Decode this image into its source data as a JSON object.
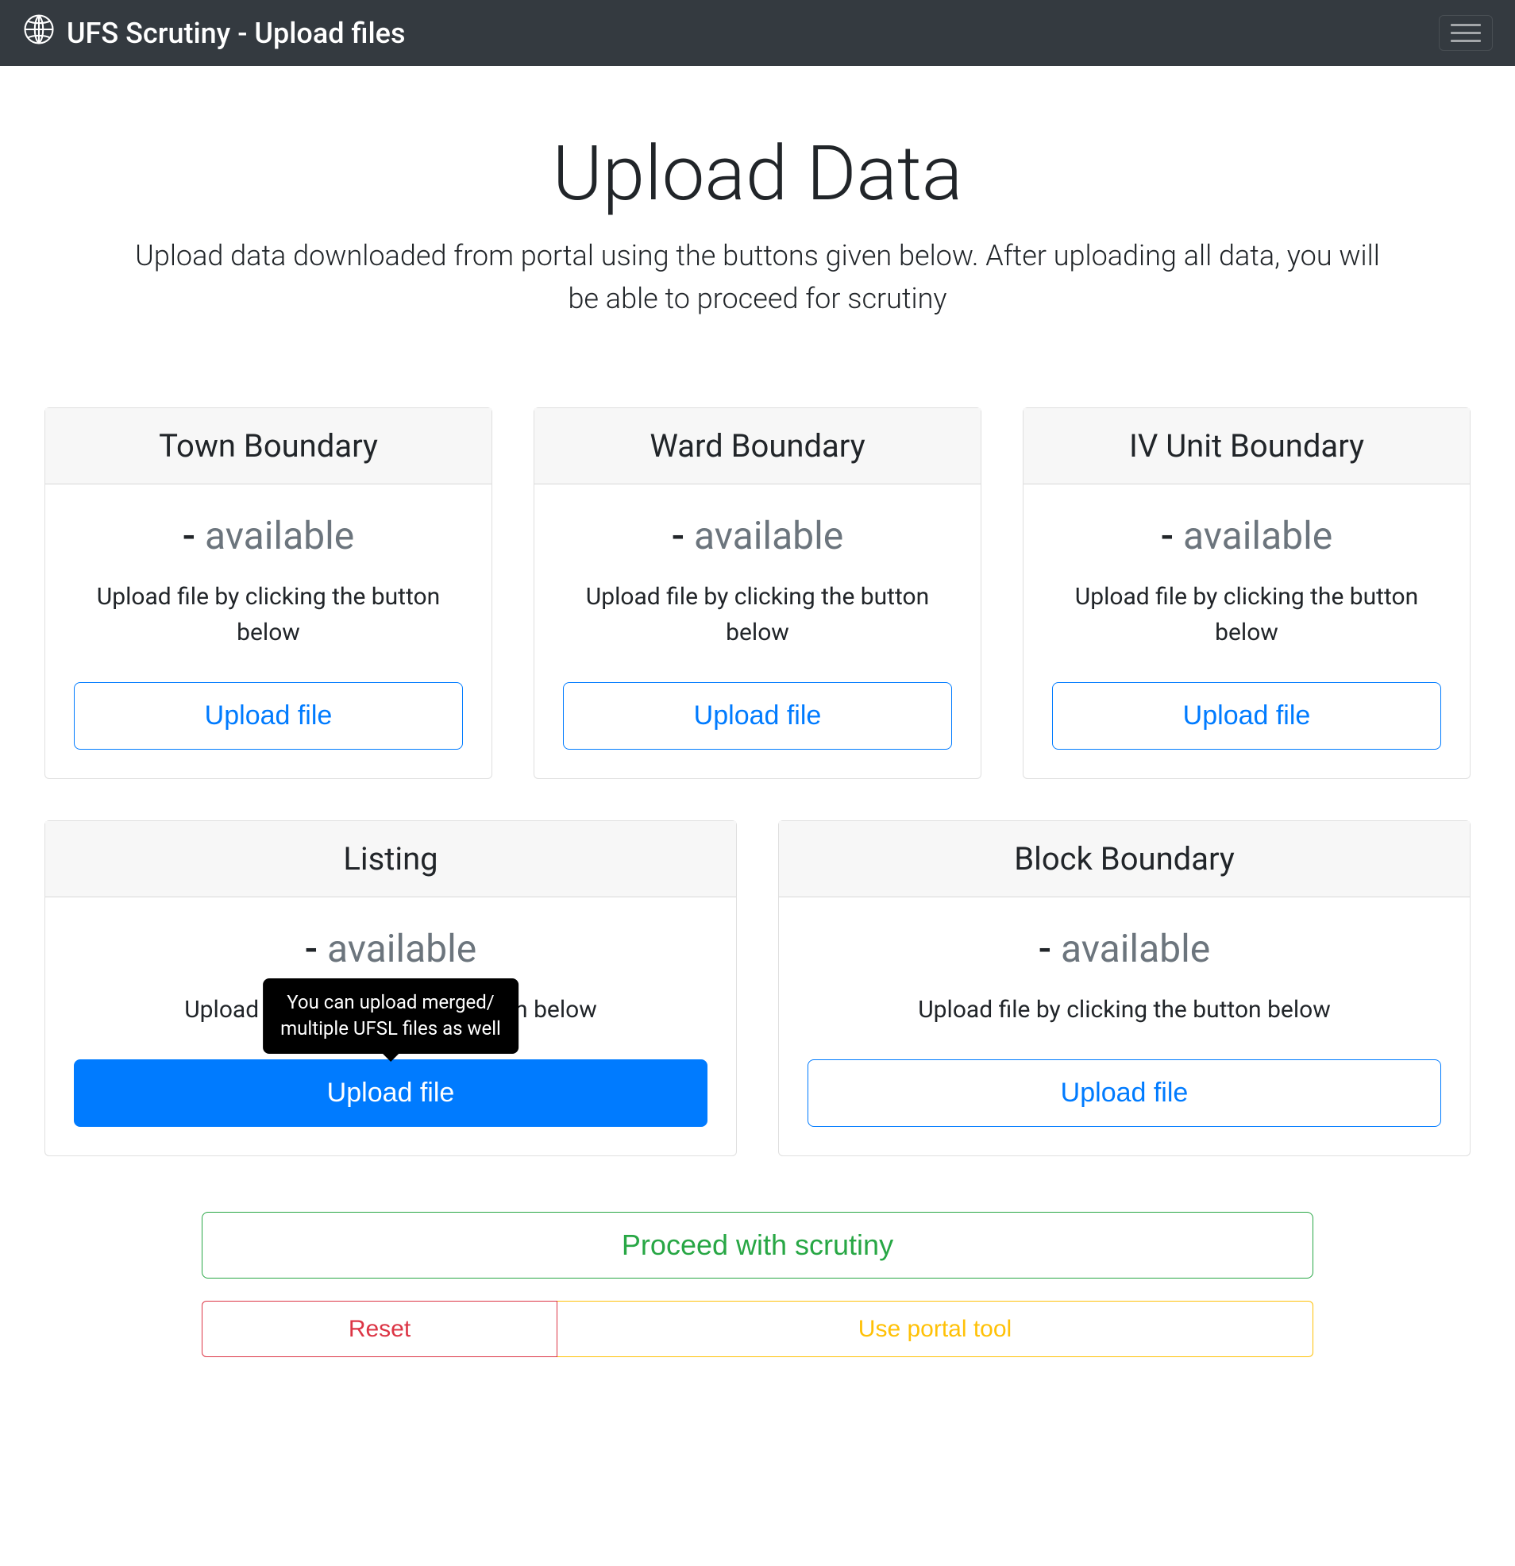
{
  "navbar": {
    "title": "UFS Scrutiny - Upload files"
  },
  "hero": {
    "title": "Upload Data",
    "subtitle": "Upload data downloaded from portal using the buttons given below. After uploading all data, you will be able to proceed for scrutiny"
  },
  "cards": {
    "town": {
      "header": "Town Boundary",
      "count": "-",
      "status": "available",
      "text": "Upload file by clicking the button below",
      "button": "Upload file"
    },
    "ward": {
      "header": "Ward Boundary",
      "count": "-",
      "status": "available",
      "text": "Upload file by clicking the button below",
      "button": "Upload file"
    },
    "iv": {
      "header": "IV Unit Boundary",
      "count": "-",
      "status": "available",
      "text": "Upload file by clicking the button below",
      "button": "Upload file"
    },
    "listing": {
      "header": "Listing",
      "count": "-",
      "status": "available",
      "text": "Upload file by clicking the button below",
      "button": "Upload file",
      "tooltip_line1": "You can upload merged/",
      "tooltip_line2": "multiple UFSL files as well"
    },
    "block": {
      "header": "Block Boundary",
      "count": "-",
      "status": "available",
      "text": "Upload file by clicking the button below",
      "button": "Upload file"
    }
  },
  "actions": {
    "proceed": "Proceed with scrutiny",
    "reset": "Reset",
    "portal": "Use portal tool"
  }
}
